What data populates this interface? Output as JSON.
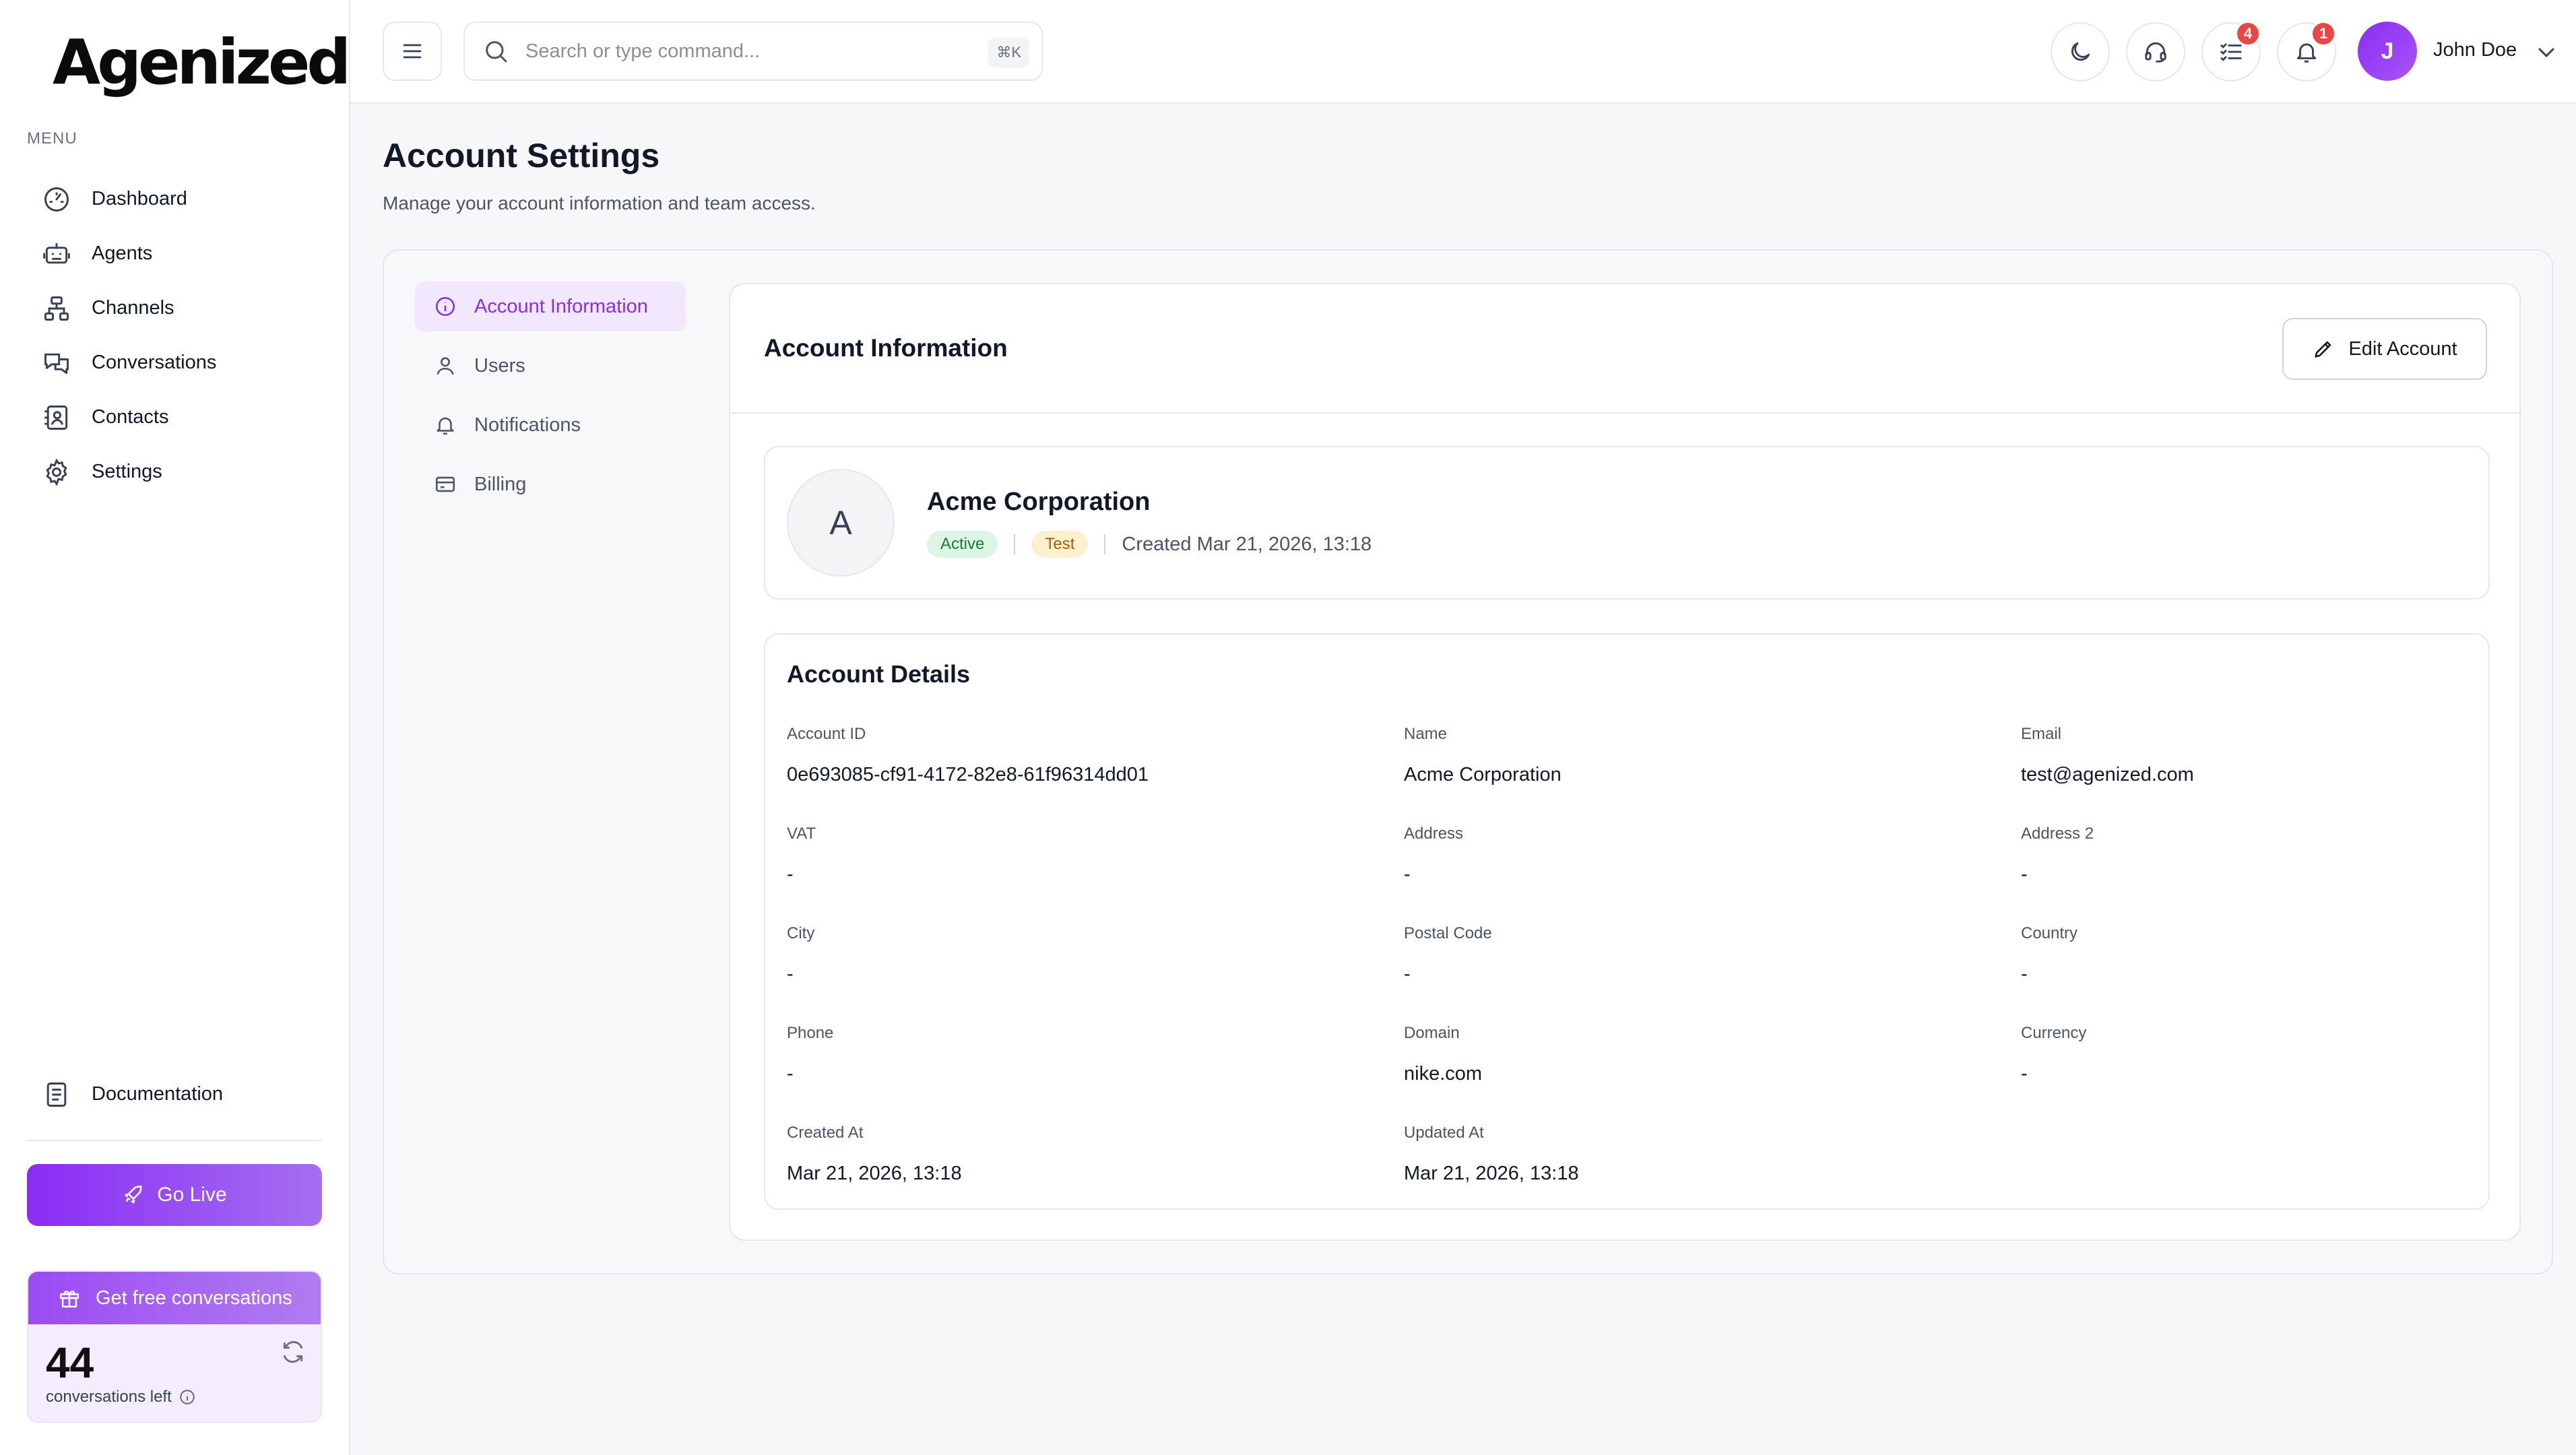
{
  "brand": {
    "logo_text": "Agenized",
    "accent": "#8b2cf5"
  },
  "sidebar": {
    "menu_label": "MENU",
    "items": [
      {
        "label": "Dashboard",
        "icon": "dashboard-gauge-icon"
      },
      {
        "label": "Agents",
        "icon": "robot-icon"
      },
      {
        "label": "Channels",
        "icon": "channels-hierarchy-icon"
      },
      {
        "label": "Conversations",
        "icon": "chat-bubbles-icon"
      },
      {
        "label": "Contacts",
        "icon": "contact-card-icon"
      },
      {
        "label": "Settings",
        "icon": "gear-icon"
      }
    ],
    "documentation_label": "Documentation",
    "go_live_label": "Go Live",
    "free_conversations": {
      "title": "Get free conversations",
      "count": "44",
      "caption": "conversations left"
    }
  },
  "header": {
    "search_placeholder": "Search or type command...",
    "search_shortcut": "⌘K",
    "tasks_badge": "4",
    "notifications_badge": "1",
    "user_initial": "J",
    "user_name": "John Doe"
  },
  "page": {
    "title": "Account Settings",
    "subtitle": "Manage your account information and team access."
  },
  "settings_nav": [
    {
      "label": "Account Information",
      "icon": "info-circle-icon",
      "active": true
    },
    {
      "label": "Users",
      "icon": "user-icon",
      "active": false
    },
    {
      "label": "Notifications",
      "icon": "bell-icon",
      "active": false
    },
    {
      "label": "Billing",
      "icon": "credit-card-icon",
      "active": false
    }
  ],
  "account_card": {
    "title": "Account Information",
    "edit_label": "Edit Account"
  },
  "profile": {
    "initial": "A",
    "name": "Acme Corporation",
    "status": "Active",
    "environment": "Test",
    "created": "Created Mar 21, 2026, 13:18"
  },
  "details": {
    "title": "Account Details",
    "fields": [
      {
        "label": "Account ID",
        "value": "0e693085-cf91-4172-82e8-61f96314dd01"
      },
      {
        "label": "Name",
        "value": "Acme Corporation"
      },
      {
        "label": "Email",
        "value": "test@agenized.com"
      },
      {
        "label": "VAT",
        "value": "-"
      },
      {
        "label": "Address",
        "value": "-"
      },
      {
        "label": "Address 2",
        "value": "-"
      },
      {
        "label": "City",
        "value": "-"
      },
      {
        "label": "Postal Code",
        "value": "-"
      },
      {
        "label": "Country",
        "value": "-"
      },
      {
        "label": "Phone",
        "value": "-"
      },
      {
        "label": "Domain",
        "value": "nike.com"
      },
      {
        "label": "Currency",
        "value": "-"
      },
      {
        "label": "Created At",
        "value": "Mar 21, 2026, 13:18"
      },
      {
        "label": "Updated At",
        "value": "Mar 21, 2026, 13:18"
      }
    ]
  }
}
